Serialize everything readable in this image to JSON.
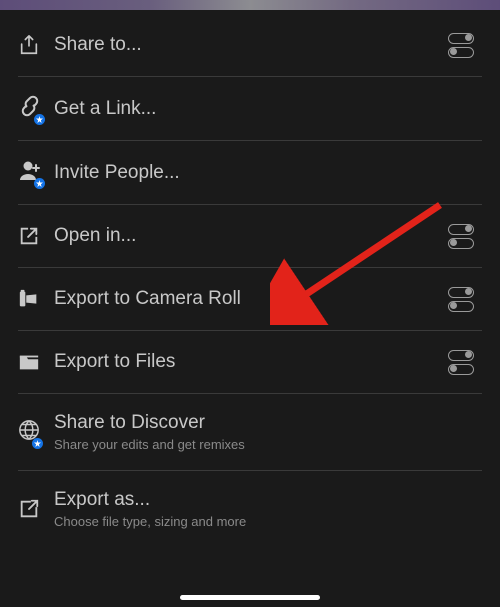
{
  "menu": {
    "share_to": {
      "label": "Share to..."
    },
    "get_link": {
      "label": "Get a Link..."
    },
    "invite": {
      "label": "Invite People..."
    },
    "open_in": {
      "label": "Open in..."
    },
    "camera_roll": {
      "label": "Export to Camera Roll"
    },
    "files": {
      "label": "Export to Files"
    },
    "discover": {
      "label": "Share to Discover",
      "sub": "Share your edits and get remixes"
    },
    "export_as": {
      "label": "Export as...",
      "sub": "Choose file type, sizing and more"
    }
  }
}
